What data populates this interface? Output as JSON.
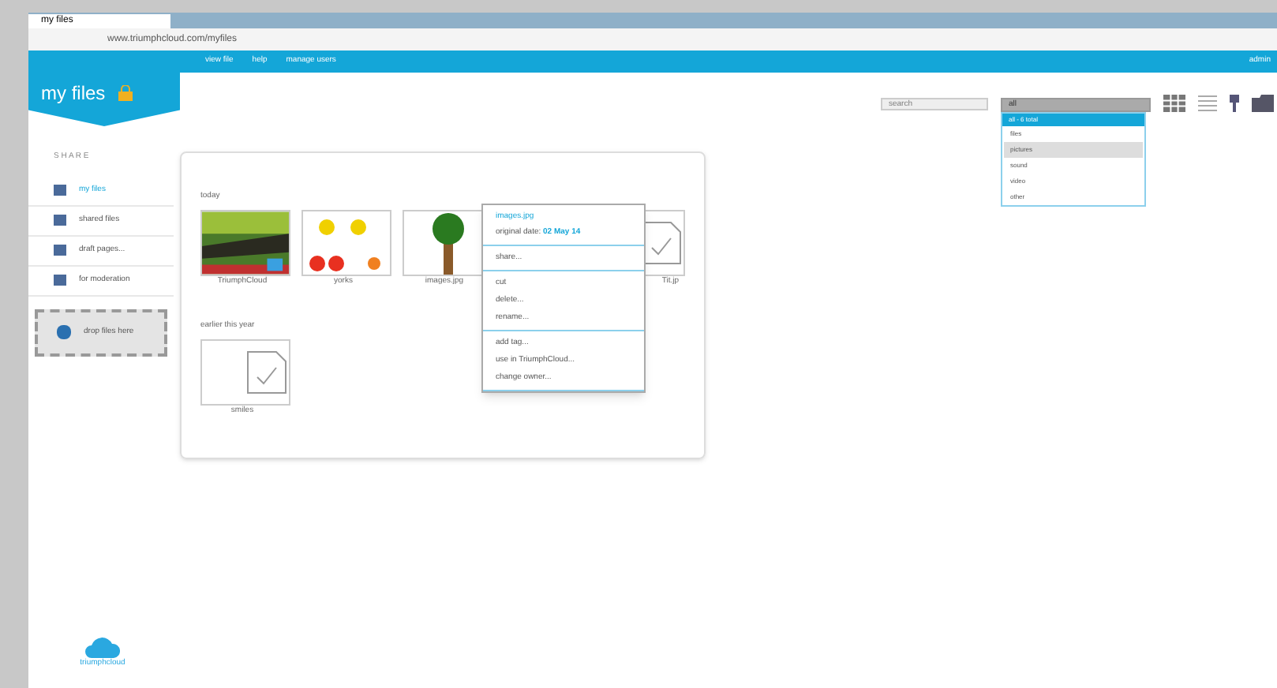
{
  "browser": {
    "tab_title": "my files",
    "url": "www.triumphcloud.com/myfiles"
  },
  "nav": {
    "links": [
      "view file",
      "help",
      "manage users"
    ],
    "right_text": "admin"
  },
  "brand": {
    "title": "my files"
  },
  "sidebar": {
    "heading": "S H A R E",
    "items": [
      {
        "label": "my files",
        "selected": true
      },
      {
        "label": "shared files",
        "selected": false
      },
      {
        "label": "draft pages...",
        "selected": false
      },
      {
        "label": "for moderation",
        "selected": false
      }
    ],
    "drop_zone": "drop files here"
  },
  "toolbar": {
    "search_placeholder": "search",
    "filter_value": "all"
  },
  "filter_menu": {
    "header": "all - 6 total",
    "items": [
      {
        "label": "files",
        "selected": false
      },
      {
        "label": "pictures",
        "selected": true
      },
      {
        "label": "sound",
        "selected": false
      },
      {
        "label": "video",
        "selected": false
      },
      {
        "label": "other",
        "selected": false
      }
    ]
  },
  "groups": [
    {
      "title": "today",
      "files": [
        {
          "name": "TriumphCloud"
        },
        {
          "name": "yorks",
          "kind": "fruit"
        },
        {
          "name": "images.jpg",
          "kind": "tree"
        },
        {
          "name": "Tit.jp",
          "kind": "doc"
        }
      ]
    },
    {
      "title": "earlier this year",
      "files": [
        {
          "name": "smiles",
          "kind": "doc"
        }
      ]
    }
  ],
  "context_menu": {
    "title": "images.jpg",
    "date_label": "original date:",
    "date": "02 May 14",
    "sections": [
      [
        "share..."
      ],
      [
        "cut",
        "delete...",
        "rename..."
      ],
      [
        "add tag...",
        "use in TriumphCloud...",
        "change owner..."
      ]
    ]
  },
  "footer_logo": "triumphcloud"
}
